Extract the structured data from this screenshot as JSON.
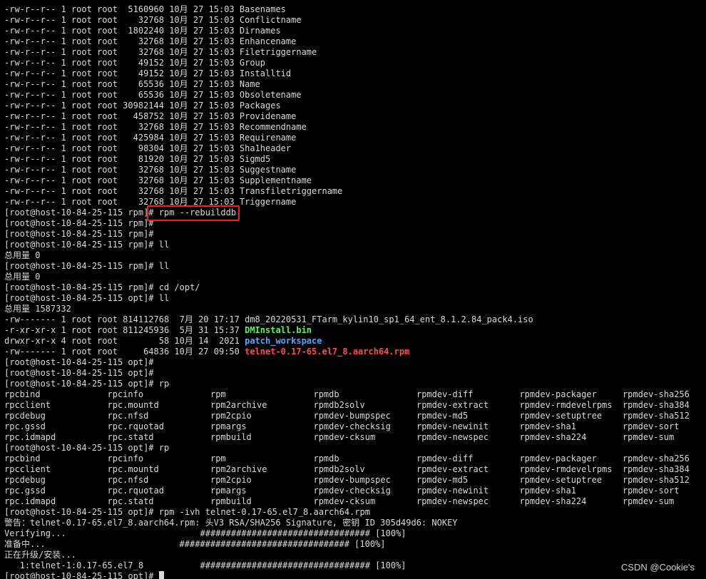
{
  "colors": {
    "background": "#000000",
    "text": "#d9d9d9",
    "executable_green": "#5cf25c",
    "directory_blue": "#4ea8ff",
    "archive_red": "#ff4d4d",
    "annotation_box": "#e5262a"
  },
  "terminal_lines": [
    {
      "segments": [
        {
          "text": "-rw-r--r-- 1 root root  5160960 10月 27 15:03 Basenames"
        }
      ]
    },
    {
      "segments": [
        {
          "text": "-rw-r--r-- 1 root root    32768 10月 27 15:03 Conflictname"
        }
      ]
    },
    {
      "segments": [
        {
          "text": "-rw-r--r-- 1 root root  1802240 10月 27 15:03 Dirnames"
        }
      ]
    },
    {
      "segments": [
        {
          "text": "-rw-r--r-- 1 root root    32768 10月 27 15:03 Enhancename"
        }
      ]
    },
    {
      "segments": [
        {
          "text": "-rw-r--r-- 1 root root    32768 10月 27 15:03 Filetriggername"
        }
      ]
    },
    {
      "segments": [
        {
          "text": "-rw-r--r-- 1 root root    49152 10月 27 15:03 Group"
        }
      ]
    },
    {
      "segments": [
        {
          "text": "-rw-r--r-- 1 root root    49152 10月 27 15:03 Installtid"
        }
      ]
    },
    {
      "segments": [
        {
          "text": "-rw-r--r-- 1 root root    65536 10月 27 15:03 Name"
        }
      ]
    },
    {
      "segments": [
        {
          "text": "-rw-r--r-- 1 root root    65536 10月 27 15:03 Obsoletename"
        }
      ]
    },
    {
      "segments": [
        {
          "text": "-rw-r--r-- 1 root root 30982144 10月 27 15:03 Packages"
        }
      ]
    },
    {
      "segments": [
        {
          "text": "-rw-r--r-- 1 root root   458752 10月 27 15:03 Providename"
        }
      ]
    },
    {
      "segments": [
        {
          "text": "-rw-r--r-- 1 root root    32768 10月 27 15:03 Recommendname"
        }
      ]
    },
    {
      "segments": [
        {
          "text": "-rw-r--r-- 1 root root   425984 10月 27 15:03 Requirename"
        }
      ]
    },
    {
      "segments": [
        {
          "text": "-rw-r--r-- 1 root root    98304 10月 27 15:03 Sha1header"
        }
      ]
    },
    {
      "segments": [
        {
          "text": "-rw-r--r-- 1 root root    81920 10月 27 15:03 Sigmd5"
        }
      ]
    },
    {
      "segments": [
        {
          "text": "-rw-r--r-- 1 root root    32768 10月 27 15:03 Suggestname"
        }
      ]
    },
    {
      "segments": [
        {
          "text": "-rw-r--r-- 1 root root    32768 10月 27 15:03 Supplementname"
        }
      ]
    },
    {
      "segments": [
        {
          "text": "-rw-r--r-- 1 root root    32768 10月 27 15:03 Transfiletriggername"
        }
      ]
    },
    {
      "segments": [
        {
          "text": "-rw-r--r-- 1 root root    32768 10月 27 15:03 Triggername"
        }
      ]
    },
    {
      "segments": [
        {
          "text": "[root@host-10-84-25-115 rpm]# rpm --rebuilddb"
        }
      ]
    },
    {
      "segments": [
        {
          "text": "[root@host-10-84-25-115 rpm]#"
        }
      ]
    },
    {
      "segments": [
        {
          "text": "[root@host-10-84-25-115 rpm]#"
        }
      ]
    },
    {
      "segments": [
        {
          "text": "[root@host-10-84-25-115 rpm]# ll"
        }
      ]
    },
    {
      "segments": [
        {
          "text": "总用量 0"
        }
      ]
    },
    {
      "segments": [
        {
          "text": "[root@host-10-84-25-115 rpm]# ll"
        }
      ]
    },
    {
      "segments": [
        {
          "text": "总用量 0"
        }
      ]
    },
    {
      "segments": [
        {
          "text": "[root@host-10-84-25-115 rpm]# cd /opt/"
        }
      ]
    },
    {
      "segments": [
        {
          "text": "[root@host-10-84-25-115 opt]# ll"
        }
      ]
    },
    {
      "segments": [
        {
          "text": "总用量 1587332"
        }
      ]
    },
    {
      "segments": [
        {
          "text": "-rw------- 1 root root 814112768  7月 20 17:17 dm8_20220531_FTarm_kylin10_sp1_64_ent_8.1.2.84_pack4.iso"
        }
      ]
    },
    {
      "segments": [
        {
          "text": "-r-xr-xr-x 1 root root 811245936  5月 31 15:37 "
        },
        {
          "text": "DMInstall.bin",
          "style": "exec"
        }
      ]
    },
    {
      "segments": [
        {
          "text": "drwxr-xr-x 4 root root        58 10月 14  2021 "
        },
        {
          "text": "patch_workspace",
          "style": "dir"
        }
      ]
    },
    {
      "segments": [
        {
          "text": "-rw------- 1 root root     64836 10月 27 09:50 "
        },
        {
          "text": "telnet-0.17-65.el7_8.aarch64.rpm",
          "style": "archive"
        }
      ]
    },
    {
      "segments": [
        {
          "text": "[root@host-10-84-25-115 opt]#"
        }
      ]
    },
    {
      "segments": [
        {
          "text": "[root@host-10-84-25-115 opt]#"
        }
      ]
    },
    {
      "segments": [
        {
          "text": "[root@host-10-84-25-115 opt]# rp"
        }
      ]
    },
    {
      "segments": [
        {
          "text": "rpcbind             rpcinfo             rpm                 rpmdb               rpmdev-diff         rpmdev-packager     rpmdev-sha256       r"
        }
      ]
    },
    {
      "segments": [
        {
          "text": "rpcclient           rpc.mountd          rpm2archive         rpmdb2solv          rpmdev-extract      rpmdev-rmdevelrpms  rpmdev-sha384       r"
        }
      ]
    },
    {
      "segments": [
        {
          "text": "rpcdebug            rpc.nfsd            rpm2cpio            rpmdev-bumpspec     rpmdev-md5          rpmdev-setuptree    rpmdev-sha512       r"
        }
      ]
    },
    {
      "segments": [
        {
          "text": "rpc.gssd            rpc.rquotad         rpmargs             rpmdev-checksig     rpmdev-newinit      rpmdev-sha1         rpmdev-sort         r"
        }
      ]
    },
    {
      "segments": [
        {
          "text": "rpc.idmapd          rpc.statd           rpmbuild            rpmdev-cksum        rpmdev-newspec      rpmdev-sha224       rpmdev-sum          r"
        }
      ]
    },
    {
      "segments": [
        {
          "text": "[root@host-10-84-25-115 opt]# rp"
        }
      ]
    },
    {
      "segments": [
        {
          "text": "rpcbind             rpcinfo             rpm                 rpmdb               rpmdev-diff         rpmdev-packager     rpmdev-sha256       r"
        }
      ]
    },
    {
      "segments": [
        {
          "text": "rpcclient           rpc.mountd          rpm2archive         rpmdb2solv          rpmdev-extract      rpmdev-rmdevelrpms  rpmdev-sha384       r"
        }
      ]
    },
    {
      "segments": [
        {
          "text": "rpcdebug            rpc.nfsd            rpm2cpio            rpmdev-bumpspec     rpmdev-md5          rpmdev-setuptree    rpmdev-sha512       r"
        }
      ]
    },
    {
      "segments": [
        {
          "text": "rpc.gssd            rpc.rquotad         rpmargs             rpmdev-checksig     rpmdev-newinit      rpmdev-sha1         rpmdev-sort         r"
        }
      ]
    },
    {
      "segments": [
        {
          "text": "rpc.idmapd          rpc.statd           rpmbuild            rpmdev-cksum        rpmdev-newspec      rpmdev-sha224       rpmdev-sum          r"
        }
      ]
    },
    {
      "segments": [
        {
          "text": "[root@host-10-84-25-115 opt]# rpm -ivh telnet-0.17-65.el7_8.aarch64.rpm"
        }
      ]
    },
    {
      "segments": [
        {
          "text": "警告：telnet-0.17-65.el7_8.aarch64.rpm: 头V3 RSA/SHA256 Signature, 密钥 ID 305d49d6: NOKEY"
        }
      ]
    },
    {
      "segments": [
        {
          "text": "Verifying...                          ################################# [100%]"
        }
      ]
    },
    {
      "segments": [
        {
          "text": "准备中...                          ################################# [100%]"
        }
      ]
    },
    {
      "segments": [
        {
          "text": "正在升级/安装..."
        }
      ]
    },
    {
      "segments": [
        {
          "text": "   1:telnet-1:0.17-65.el7_8           ################################# [100%]"
        }
      ]
    },
    {
      "segments": [
        {
          "text": "[root@host-10-84-25-115 opt]# "
        }
      ],
      "cursor": true
    }
  ],
  "watermark": "CSDN @Cookie's"
}
